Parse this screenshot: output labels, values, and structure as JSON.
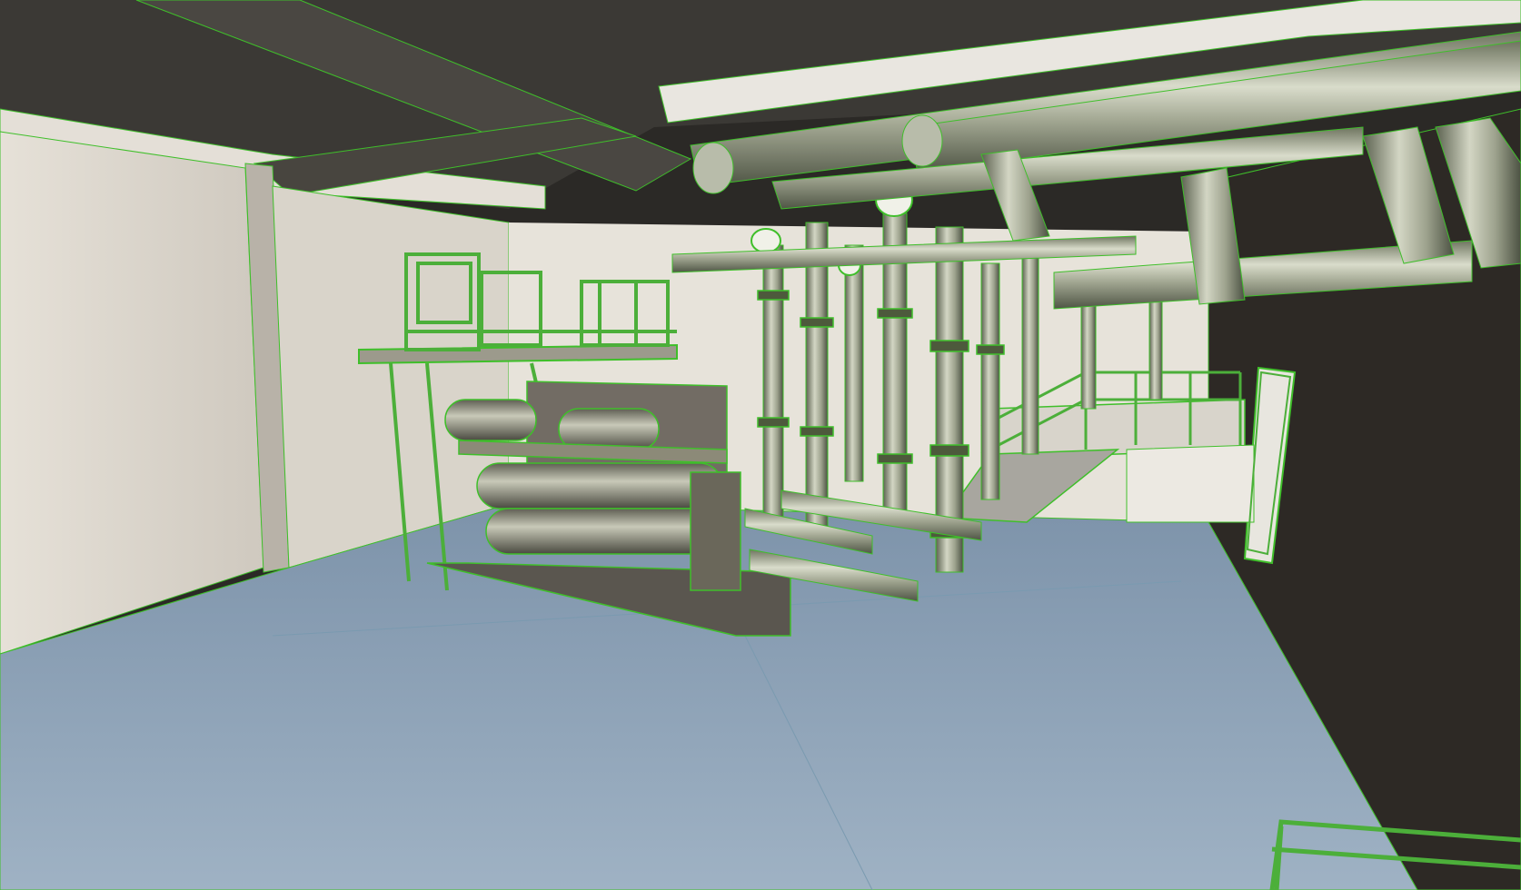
{
  "viewport": {
    "render_mode": "shaded-with-wireframe-edges",
    "edge_color": "#3fbf2a",
    "colors": {
      "floor": "#8aa0b6",
      "floor_light": "#a9bccd",
      "ceiling": "#3a3834",
      "wall_left": "#ddd8cf",
      "wall_right": "#2a2622",
      "beam": "#e8e4dd",
      "pipe": "#b8bcaa",
      "pipe_dark": "#6f7565",
      "equipment": "#8a8a78",
      "railing": "#4caf3a"
    }
  }
}
